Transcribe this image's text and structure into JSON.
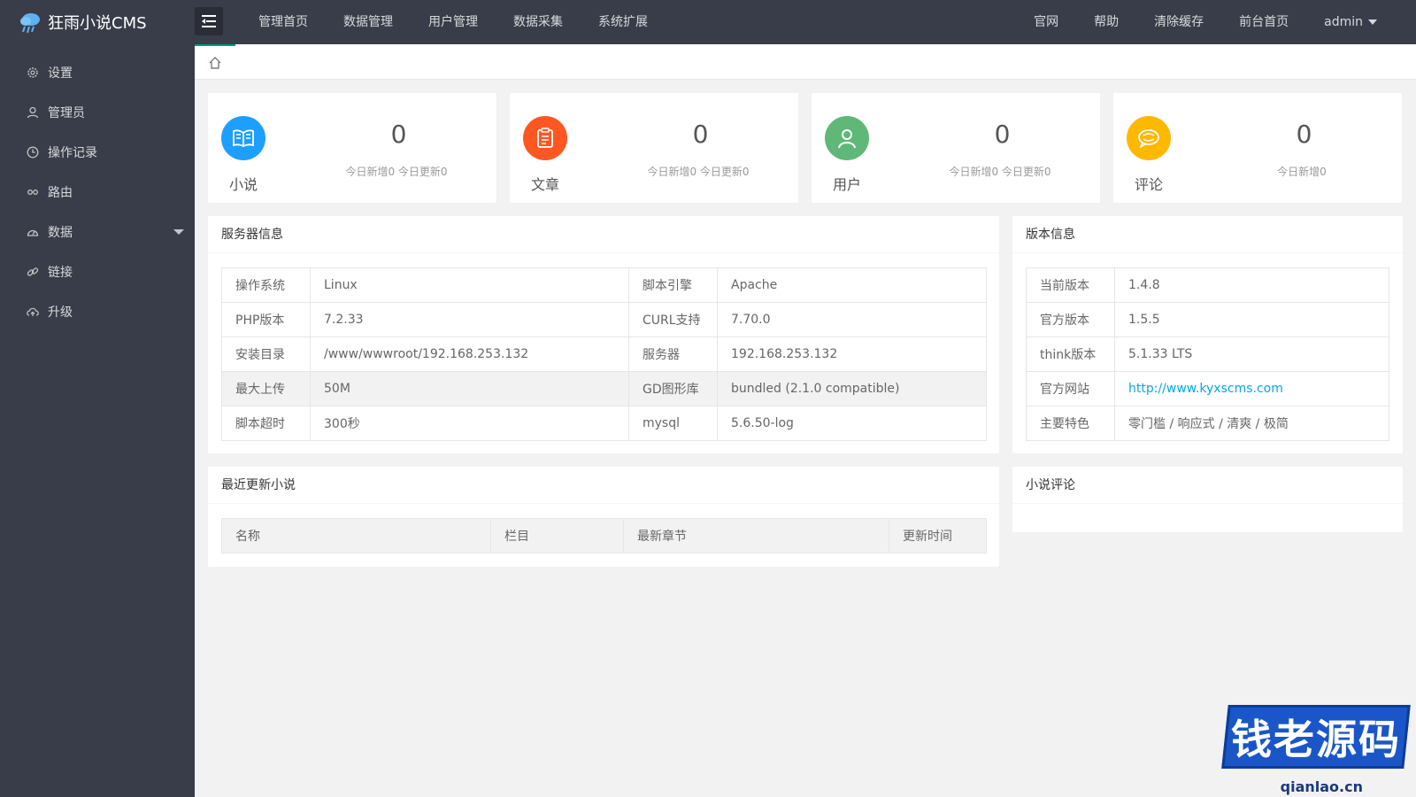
{
  "app": {
    "title": "狂雨小说CMS"
  },
  "topnav": {
    "left": [
      "管理首页",
      "数据管理",
      "用户管理",
      "数据采集",
      "系统扩展"
    ],
    "right": [
      "官网",
      "帮助",
      "清除缓存",
      "前台首页"
    ],
    "user": "admin"
  },
  "sidebar": {
    "items": [
      {
        "label": "设置",
        "icon": "gear-icon"
      },
      {
        "label": "管理员",
        "icon": "user-icon"
      },
      {
        "label": "操作记录",
        "icon": "clock-icon"
      },
      {
        "label": "路由",
        "icon": "route-icon"
      },
      {
        "label": "数据",
        "icon": "dashboard-icon",
        "expandable": true
      },
      {
        "label": "链接",
        "icon": "link-icon"
      },
      {
        "label": "升级",
        "icon": "upgrade-icon"
      }
    ]
  },
  "stats": [
    {
      "label": "小说",
      "count": "0",
      "sub": "今日新增0 今日更新0",
      "color": "#1e9fff",
      "icon": "book-icon"
    },
    {
      "label": "文章",
      "count": "0",
      "sub": "今日新增0 今日更新0",
      "color": "#ff5722",
      "icon": "article-icon"
    },
    {
      "label": "用户",
      "count": "0",
      "sub": "今日新增0 今日更新0",
      "color": "#5fb878",
      "icon": "user-icon"
    },
    {
      "label": "评论",
      "count": "0",
      "sub": "今日新增0",
      "color": "#ffb800",
      "icon": "comment-icon"
    }
  ],
  "server": {
    "title": "服务器信息",
    "rows": [
      [
        "操作系统",
        "Linux",
        "脚本引擎",
        "Apache"
      ],
      [
        "PHP版本",
        "7.2.33",
        "CURL支持",
        "7.70.0"
      ],
      [
        "安装目录",
        "/www/wwwroot/192.168.253.132",
        "服务器",
        "192.168.253.132"
      ],
      [
        "最大上传",
        "50M",
        "GD图形库",
        "bundled (2.1.0 compatible)"
      ],
      [
        "脚本超时",
        "300秒",
        "mysql",
        "5.6.50-log"
      ]
    ]
  },
  "version": {
    "title": "版本信息",
    "rows": [
      [
        "当前版本",
        "1.4.8"
      ],
      [
        "官方版本",
        "1.5.5"
      ],
      [
        "think版本",
        "5.1.33 LTS"
      ],
      [
        "官方网站",
        "http://www.kyxscms.com"
      ],
      [
        "主要特色",
        "零门槛 / 响应式 / 清爽 / 极简"
      ]
    ]
  },
  "recent": {
    "title": "最近更新小说",
    "headers": [
      "名称",
      "栏目",
      "最新章节",
      "更新时间"
    ]
  },
  "comments": {
    "title": "小说评论"
  },
  "watermark": {
    "text": "钱老源码",
    "url": "qianlao.cn"
  }
}
